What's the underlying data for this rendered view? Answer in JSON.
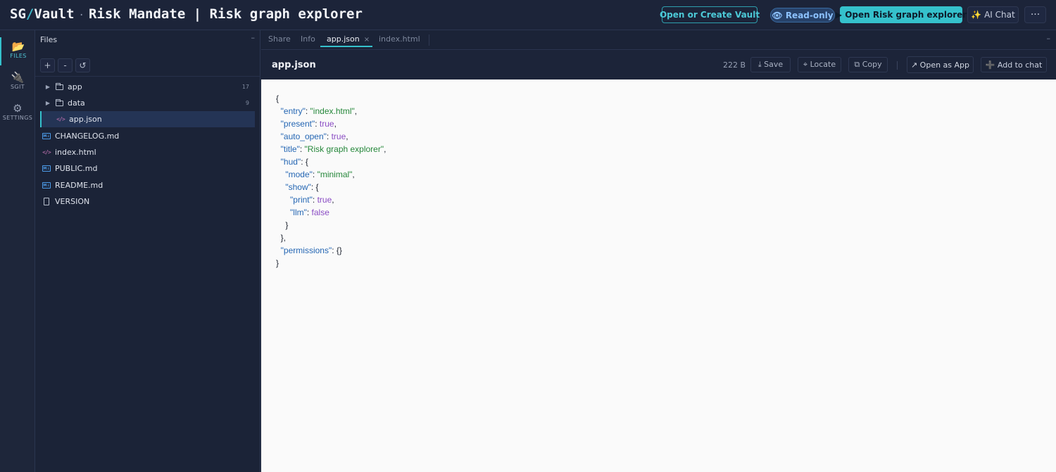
{
  "topbar": {
    "brand_sg": "SG",
    "brand_slash": "/",
    "brand_vault": "Vault",
    "brand_sep": "·",
    "page_title": "Risk Mandate | Risk graph explorer",
    "open_vault_label": "Open or Create Vault",
    "readonly_label": "👁 Read-only",
    "open_app_label": "▶ Open Risk graph explorer",
    "ai_chat_label": "✨ AI Chat",
    "more_label": "···"
  },
  "rail": {
    "files": {
      "icon": "folder-open-icon",
      "glyph": "📂",
      "label": "FILES"
    },
    "sgit": {
      "icon": "plug-icon",
      "glyph": "🔌",
      "label": "SGIT"
    },
    "settings": {
      "icon": "gear-icon",
      "glyph": "⚙",
      "label": "SETTINGS"
    }
  },
  "files_panel": {
    "title": "Files",
    "collapse": "–",
    "tools": {
      "add": "+",
      "remove": "-",
      "refresh": "↺"
    },
    "tree": [
      {
        "name": "app",
        "type": "folder",
        "count": "17"
      },
      {
        "name": "data",
        "type": "folder",
        "count": "9"
      },
      {
        "name": "app.json",
        "type": "code",
        "selected": true
      },
      {
        "name": "CHANGELOG.md",
        "type": "md"
      },
      {
        "name": "index.html",
        "type": "code"
      },
      {
        "name": "PUBLIC.md",
        "type": "md"
      },
      {
        "name": "README.md",
        "type": "md"
      },
      {
        "name": "VERSION",
        "type": "doc"
      }
    ]
  },
  "editor": {
    "tabs": {
      "share": "Share",
      "info": "Info",
      "app_json": "app.json",
      "close": "×",
      "index_html": "index.html",
      "collapse": "–"
    },
    "filename": "app.json",
    "size": "222 B",
    "buttons": {
      "save": "⤓ Save",
      "locate": "⌖ Locate",
      "copy": "⧉ Copy",
      "open_as_app": "↗ Open as App",
      "add_to_chat": "➕ Add to chat"
    }
  },
  "accent": "#35c1cc"
}
